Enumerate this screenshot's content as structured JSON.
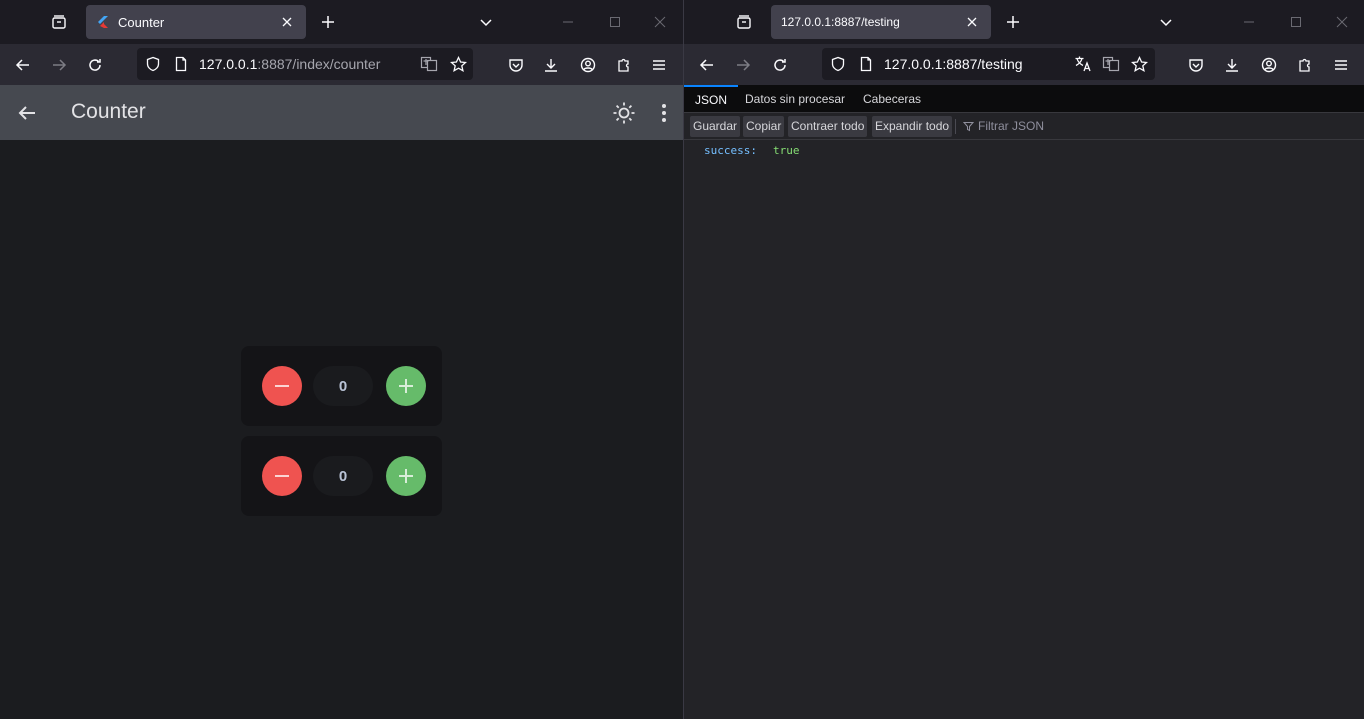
{
  "left": {
    "tab": {
      "title": "Counter"
    },
    "url": {
      "host": "127.0.0.1",
      "rest": ":8887/index/counter"
    },
    "app": {
      "title": "Counter",
      "counters": [
        {
          "value": "0"
        },
        {
          "value": "0"
        }
      ]
    }
  },
  "right": {
    "tab": {
      "title": "127.0.0.1:8887/testing"
    },
    "url": {
      "host": "127.0.0.1:8887/testing",
      "rest": ""
    },
    "viewer": {
      "tabs": [
        "JSON",
        "Datos sin procesar",
        "Cabeceras"
      ],
      "toolbar": [
        "Guardar",
        "Copiar",
        "Contraer todo",
        "Expandir todo"
      ],
      "filter_placeholder": "Filtrar JSON",
      "rows": [
        {
          "key": "success:",
          "value": "true"
        }
      ]
    }
  },
  "colors": {
    "minus": "#ef5350",
    "plus": "#66bb6a",
    "accent": "#0a84ff"
  }
}
